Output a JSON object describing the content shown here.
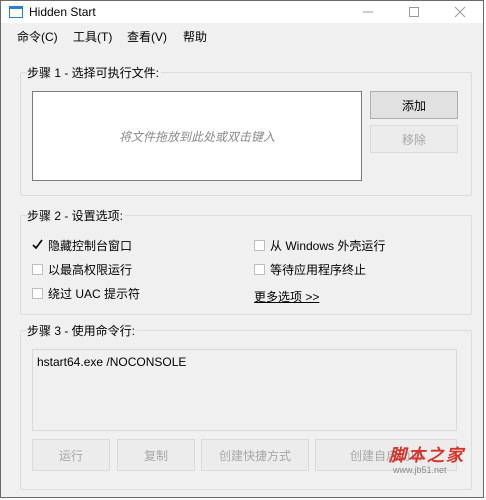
{
  "window": {
    "title": "Hidden Start"
  },
  "titlebar": {
    "minimize": "—",
    "maximize": "☐",
    "close": "✕"
  },
  "menu": [
    "命令(C)",
    "工具(T)",
    "查看(V)",
    "帮助"
  ],
  "step1": {
    "title": "步骤 1 - 选择可执行文件:",
    "dropzone_hint": "将文件拖放到此处或双击键入",
    "add_label": "添加",
    "remove_label": "移除"
  },
  "step2": {
    "title": "步骤 2 - 设置选项:",
    "options": [
      {
        "label": "隐藏控制台窗口",
        "checked": true
      },
      {
        "label": "以最高权限运行",
        "checked": false
      },
      {
        "label": "绕过 UAC 提示符",
        "checked": false
      },
      {
        "label": "从 Windows 外壳运行",
        "checked": false
      },
      {
        "label": "等待应用程序终止",
        "checked": false
      }
    ],
    "more_link": "更多选项 >>"
  },
  "step3": {
    "title": "步骤 3 - 使用命令行:",
    "command": "hstart64.exe /NOCONSOLE"
  },
  "actions": {
    "run": "运行",
    "copy": "复制",
    "shortcut": "创建快捷方式",
    "autostart": "创建自启动项"
  },
  "watermark": {
    "main": "脚本之家",
    "sub": "www.jb51.net"
  },
  "colors": {
    "accent": "#2a7fd4",
    "watermark": "#d6342b"
  }
}
